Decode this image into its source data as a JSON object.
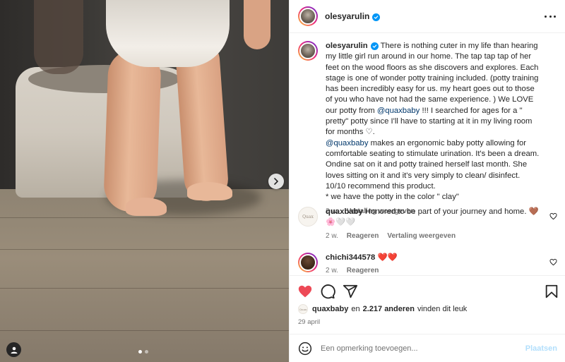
{
  "post": {
    "author": "olesyarulin",
    "verified": true
  },
  "caption": {
    "author": "olesyarulin",
    "text_part1": "There is nothing cuter in my life than hearing my little girl run around in our home. The tap tap tap of her feet on the wood floors as she discovers and explores. Each stage is one of wonder potty training included. (potty training has been incredibly easy for us. my heart goes out to those of you who have not had the same experience. ) We LOVE our potty from ",
    "mention1": "@quaxbaby",
    "text_part2": " !!! I searched for ages for a \" pretty\" potty since I'll have to starting at it in my living room for months ",
    "heart_emoji": "♡",
    "text_part3": ".",
    "mention2": "@quaxbaby",
    "text_part4": " makes an ergonomic baby potty allowing for comfortable seating to stimulate urination. It's been a dream. Ondine sat on it and potty trained herself last month. She loves sitting on it and it's very simply to clean/ disinfect. 10/10 recommend this product.",
    "text_part5": "* we have the potty in the color \" clay\"",
    "time": "2 w.",
    "translate": "Vertaling weergeven"
  },
  "comments": [
    {
      "author": "quaxbaby",
      "avatar_label": "Quax",
      "text": "Honored to be part of your journey and home.",
      "emoji": "🤎",
      "emoji2": "🌸🤍🤍",
      "time": "2 w.",
      "reply": "Reageren",
      "translate": "Vertaling weergeven"
    },
    {
      "author": "chichi344578",
      "text": "❤️❤️",
      "time": "2 w.",
      "reply": "Reageren"
    }
  ],
  "likes": {
    "avatar_label": "Quax",
    "first_user": "quaxbaby",
    "connector": "en",
    "count_text": "2.217 anderen",
    "suffix": "vinden dit leuk"
  },
  "date": "29 april",
  "add_comment": {
    "placeholder": "Een opmerking toevoegen...",
    "post_label": "Plaatsen"
  },
  "carousel": {
    "total": 2,
    "current": 1
  },
  "colors": {
    "like_active": "#ed4956",
    "link": "#00376b",
    "verified": "#0095f6"
  },
  "icons": [
    "chevron-right-icon",
    "user-tag-icon",
    "more-icon",
    "verified-icon",
    "heart-icon",
    "comment-icon",
    "share-icon",
    "bookmark-icon",
    "emoji-icon"
  ]
}
